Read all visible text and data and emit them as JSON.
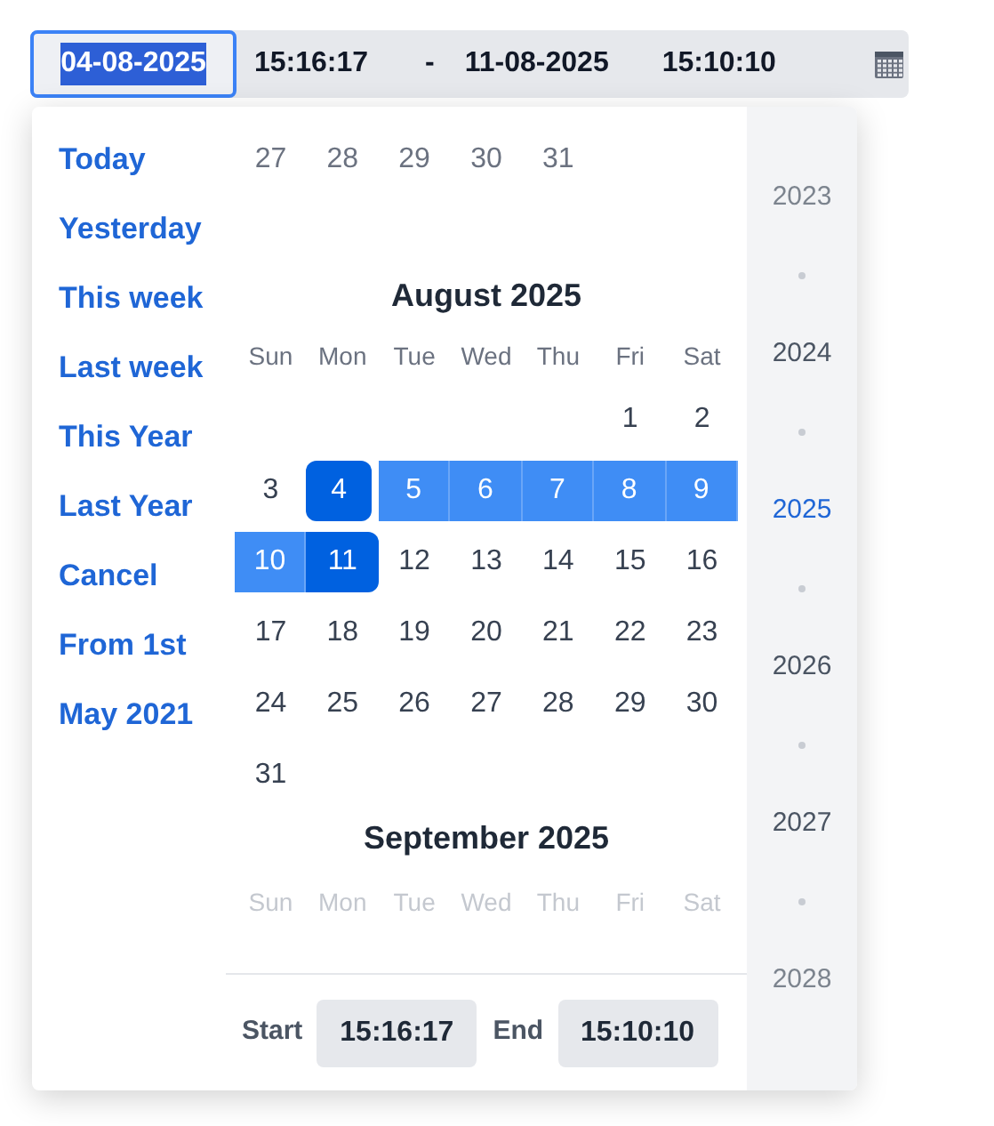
{
  "range_input": {
    "start_date": {
      "value": "04-08-2025",
      "selected": true
    },
    "start_time": "15:16:17",
    "separator": "-",
    "end_date": "11-08-2025",
    "end_time": "15:10:10"
  },
  "shortcuts": [
    "Today",
    "Yesterday",
    "This week",
    "Last week",
    "This Year",
    "Last Year",
    "Cancel",
    "From 1st",
    "May 2021"
  ],
  "previous_month_tail": [
    "27",
    "28",
    "29",
    "30",
    "31"
  ],
  "months": [
    {
      "title": "August 2025",
      "weekdays": [
        "Sun",
        "Mon",
        "Tue",
        "Wed",
        "Thu",
        "Fri",
        "Sat"
      ],
      "days": [
        {
          "label": "1",
          "selected": false,
          "in_range": false
        },
        {
          "label": "2",
          "selected": false,
          "in_range": false
        },
        {
          "label": "3",
          "selected": false,
          "in_range": false
        },
        {
          "label": "4",
          "selected": true,
          "in_range": true
        },
        {
          "label": "5",
          "selected": false,
          "in_range": true
        },
        {
          "label": "6",
          "selected": false,
          "in_range": true
        },
        {
          "label": "7",
          "selected": false,
          "in_range": true
        },
        {
          "label": "8",
          "selected": false,
          "in_range": true
        },
        {
          "label": "9",
          "selected": false,
          "in_range": true
        },
        {
          "label": "10",
          "selected": false,
          "in_range": true
        },
        {
          "label": "11",
          "selected": true,
          "in_range": true
        },
        {
          "label": "12",
          "selected": false,
          "in_range": false
        },
        {
          "label": "13",
          "selected": false,
          "in_range": false
        },
        {
          "label": "14",
          "selected": false,
          "in_range": false
        },
        {
          "label": "15",
          "selected": false,
          "in_range": false
        },
        {
          "label": "16",
          "selected": false,
          "in_range": false
        },
        {
          "label": "17",
          "selected": false,
          "in_range": false
        },
        {
          "label": "18",
          "selected": false,
          "in_range": false
        },
        {
          "label": "19",
          "selected": false,
          "in_range": false
        },
        {
          "label": "20",
          "selected": false,
          "in_range": false
        },
        {
          "label": "21",
          "selected": false,
          "in_range": false
        },
        {
          "label": "22",
          "selected": false,
          "in_range": false
        },
        {
          "label": "23",
          "selected": false,
          "in_range": false
        },
        {
          "label": "24",
          "selected": false,
          "in_range": false
        },
        {
          "label": "25",
          "selected": false,
          "in_range": false
        },
        {
          "label": "26",
          "selected": false,
          "in_range": false
        },
        {
          "label": "27",
          "selected": false,
          "in_range": false
        },
        {
          "label": "28",
          "selected": false,
          "in_range": false
        },
        {
          "label": "29",
          "selected": false,
          "in_range": false
        },
        {
          "label": "30",
          "selected": false,
          "in_range": false
        },
        {
          "label": "31",
          "selected": false,
          "in_range": false
        }
      ]
    },
    {
      "title": "September 2025",
      "weekdays": [
        "Sun",
        "Mon",
        "Tue",
        "Wed",
        "Thu",
        "Fri",
        "Sat"
      ]
    }
  ],
  "footer": {
    "start_label": "Start",
    "start_time": "15:16:17",
    "end_label": "End",
    "end_time": "15:10:10"
  },
  "years": [
    {
      "label": "2023",
      "selected": false,
      "faded": true
    },
    {
      "label": "2024",
      "selected": false,
      "faded": false
    },
    {
      "label": "2025",
      "selected": true,
      "faded": false
    },
    {
      "label": "2026",
      "selected": false,
      "faded": false
    },
    {
      "label": "2027",
      "selected": false,
      "faded": false
    },
    {
      "label": "2028",
      "selected": false,
      "faded": true
    }
  ]
}
